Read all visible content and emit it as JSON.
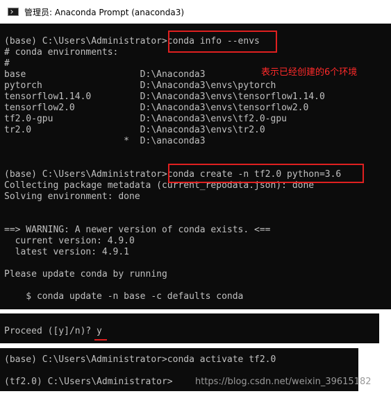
{
  "window": {
    "title": "管理员: Anaconda Prompt (anaconda3)"
  },
  "console_lines": [
    "(base) C:\\Users\\Administrator>conda info --envs",
    "# conda environments:",
    "#",
    "base                     D:\\Anaconda3",
    "pytorch                  D:\\Anaconda3\\envs\\pytorch",
    "tensorflow1.14.0         D:\\Anaconda3\\envs\\tensorflow1.14.0",
    "tensorflow2.0            D:\\Anaconda3\\envs\\tensorflow2.0",
    "tf2.0-gpu                D:\\Anaconda3\\envs\\tf2.0-gpu",
    "tr2.0                    D:\\Anaconda3\\envs\\tr2.0",
    "                      *  D:\\anaconda3",
    "",
    "",
    "(base) C:\\Users\\Administrator>conda create -n tf2.0 python=3.6",
    "Collecting package metadata (current_repodata.json): done",
    "Solving environment: done",
    "",
    "",
    "==> WARNING: A newer version of conda exists. <==",
    "  current version: 4.9.0",
    "  latest version: 4.9.1",
    "",
    "Please update conda by running",
    "",
    "    $ conda update -n base -c defaults conda"
  ],
  "annotation": "表示已经创建的6个环境",
  "proceed_prompt": "Proceed ([y]/n)? y",
  "activate_lines": [
    "(base) C:\\Users\\Administrator>conda activate tf2.0",
    "",
    "(tf2.0) C:\\Users\\Administrator>"
  ],
  "watermark": "https://blog.csdn.net/weixin_39615182",
  "colors": {
    "console_bg": "#0c0c0c",
    "console_text": "#c0c0c0",
    "highlight": "#e02020"
  }
}
